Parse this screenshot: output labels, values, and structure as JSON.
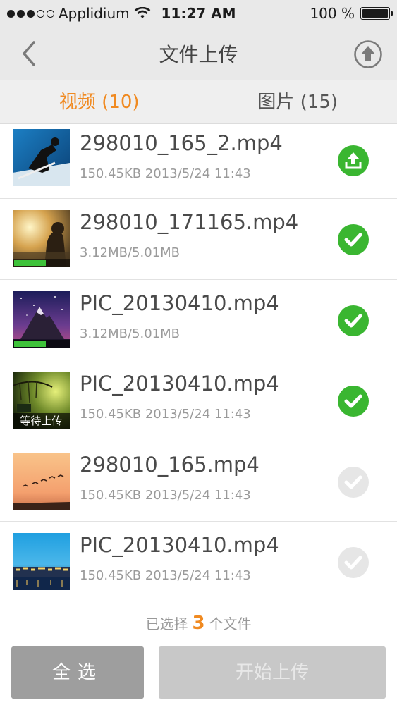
{
  "status_bar": {
    "carrier": "Applidium",
    "time": "11:27 AM",
    "battery_text": "100 %"
  },
  "navbar": {
    "title": "文件上传",
    "back_icon": "chevron-left-icon",
    "upload_icon": "upload-circle-icon"
  },
  "tabs": [
    {
      "label": "视频 (10)",
      "active": true
    },
    {
      "label": "图片 (15)",
      "active": false
    }
  ],
  "files": [
    {
      "name": "298010_165_2.mp4",
      "meta": "150.45KB 2013/5/24 11:43",
      "state": "uploading"
    },
    {
      "name": "298010_171165.mp4",
      "meta": "3.12MB/5.01MB",
      "state": "checked",
      "progress": 0.55
    },
    {
      "name": "PIC_20130410.mp4",
      "meta": "3.12MB/5.01MB",
      "state": "checked",
      "progress": 0.55
    },
    {
      "name": "PIC_20130410.mp4",
      "meta": "150.45KB 2013/5/24 11:43",
      "state": "checked",
      "overlay_label": "等待上传"
    },
    {
      "name": "298010_165.mp4",
      "meta": "150.45KB 2013/5/24 11:43",
      "state": "unchecked"
    },
    {
      "name": "PIC_20130410.mp4",
      "meta": "150.45KB 2013/5/24 11:43",
      "state": "unchecked"
    }
  ],
  "footer": {
    "selected_prefix": "已选择",
    "selected_count": "3",
    "selected_suffix": "个文件",
    "select_all_label": "全选",
    "start_upload_label": "开始上传"
  },
  "colors": {
    "accent": "#f08a21",
    "check_green": "#3ab631",
    "check_inactive": "#e6e6e6"
  }
}
